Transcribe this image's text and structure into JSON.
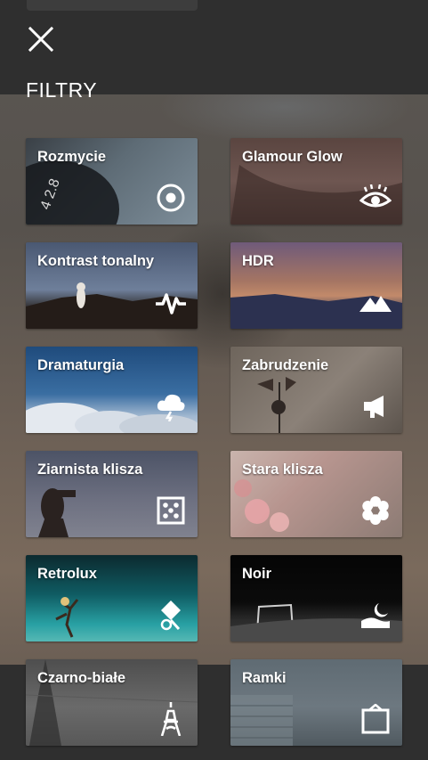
{
  "header": {
    "close_icon": "close-icon",
    "title": "FILTRY"
  },
  "filters": [
    {
      "label": "Rozmycie",
      "icon": "target-icon"
    },
    {
      "label": "Glamour Glow",
      "icon": "eye-icon"
    },
    {
      "label": "Kontrast tonalny",
      "icon": "pulse-icon"
    },
    {
      "label": "HDR",
      "icon": "mountains-icon"
    },
    {
      "label": "Dramaturgia",
      "icon": "storm-cloud-icon"
    },
    {
      "label": "Zabrudzenie",
      "icon": "megaphone-icon"
    },
    {
      "label": "Ziarnista klisza",
      "icon": "dice-icon"
    },
    {
      "label": "Stara klisza",
      "icon": "flower-icon"
    },
    {
      "label": "Retrolux",
      "icon": "retrolux-icon"
    },
    {
      "label": "Noir",
      "icon": "moon-landscape-icon"
    },
    {
      "label": "Czarno-białe",
      "icon": "eiffel-tower-icon"
    },
    {
      "label": "Ramki",
      "icon": "frame-icon"
    }
  ]
}
